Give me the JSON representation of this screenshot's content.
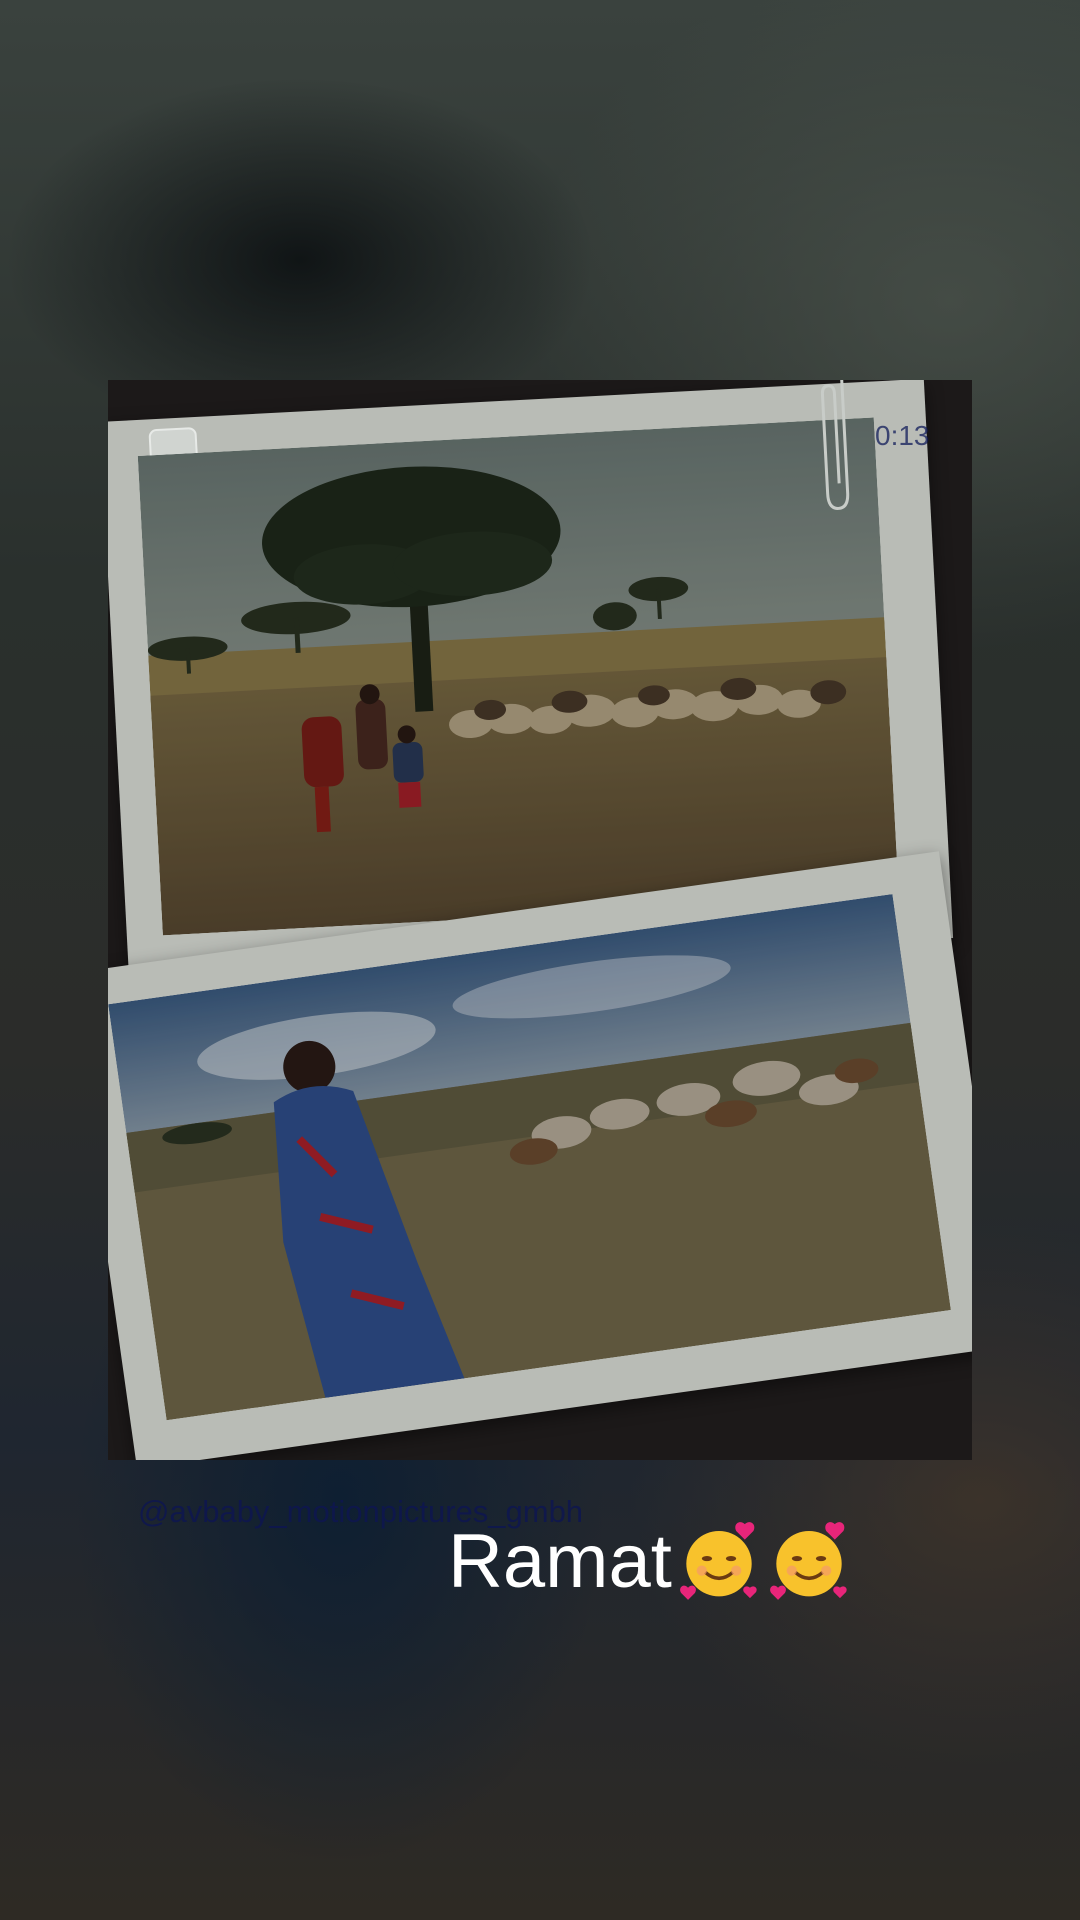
{
  "story": {
    "timestamp": "0:13",
    "watermark": "@avbaby_motionpictures_gmbh",
    "caption": "Ramat",
    "caption_emoji": [
      "smiling-face-with-hearts-icon",
      "smiling-face-with-hearts-icon"
    ]
  },
  "photos": [
    {
      "subject": "herders-with-sheep-under-tree"
    },
    {
      "subject": "herder-in-blue-with-goats"
    }
  ],
  "colors": {
    "caption": "#ffffff",
    "watermark": "#0e1650",
    "frame": "#b9bcb6",
    "collage_bg": "#1c1919"
  }
}
